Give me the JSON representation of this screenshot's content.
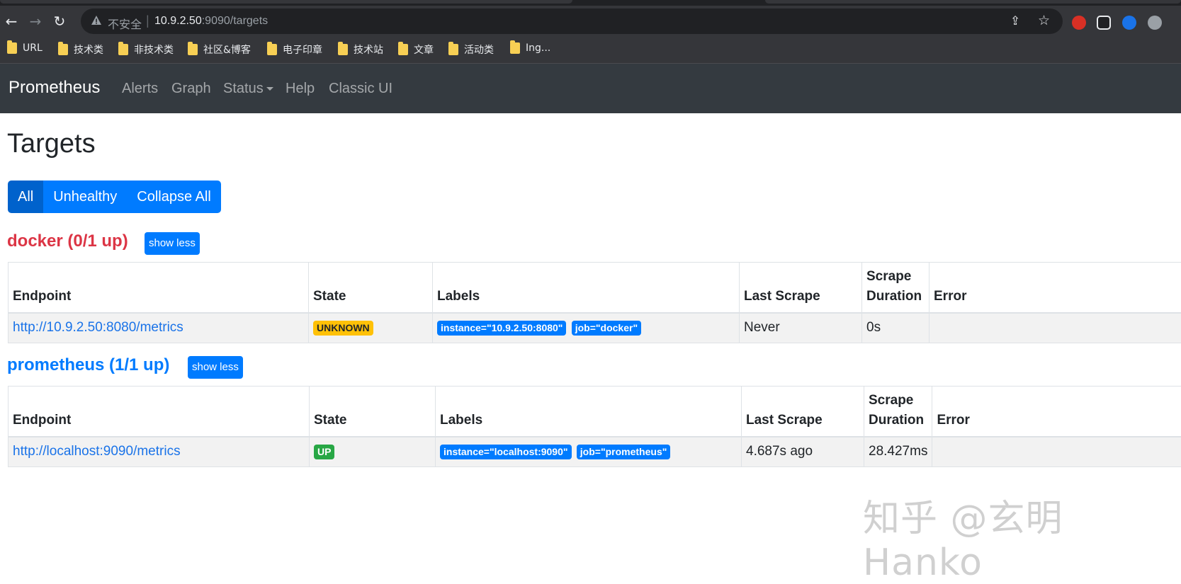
{
  "browser": {
    "insecure_label": "不安全",
    "url_host": "10.9.2.50",
    "url_path": ":9090/targets",
    "bookmarks": [
      "URL",
      "技术类",
      "非技术类",
      "社区&博客",
      "电子印章",
      "技术站",
      "文章",
      "活动类",
      "Ing..."
    ]
  },
  "navbar": {
    "brand": "Prometheus",
    "links": [
      "Alerts",
      "Graph",
      "Status",
      "Help",
      "Classic UI"
    ]
  },
  "page": {
    "title": "Targets",
    "filters": [
      "All",
      "Unhealthy",
      "Collapse All"
    ],
    "show_less_label": "show less",
    "columns": [
      "Endpoint",
      "State",
      "Labels",
      "Last Scrape",
      "Scrape Duration",
      "Error"
    ],
    "pools": [
      {
        "title": "docker (0/1 up)",
        "title_color": "#dc3545",
        "rows": [
          {
            "endpoint": "http://10.9.2.50:8080/metrics",
            "state": "UNKNOWN",
            "labels": [
              "instance=\"10.9.2.50:8080\"",
              "job=\"docker\""
            ],
            "last_scrape": "Never",
            "scrape_duration": "0s",
            "error": ""
          }
        ]
      },
      {
        "title": "prometheus (1/1 up)",
        "title_color": "#007bff",
        "rows": [
          {
            "endpoint": "http://localhost:9090/metrics",
            "state": "UP",
            "labels": [
              "instance=\"localhost:9090\"",
              "job=\"prometheus\""
            ],
            "last_scrape": "4.687s ago",
            "scrape_duration": "28.427ms",
            "error": ""
          }
        ]
      }
    ]
  },
  "watermark": "知乎 @玄明Hanko"
}
